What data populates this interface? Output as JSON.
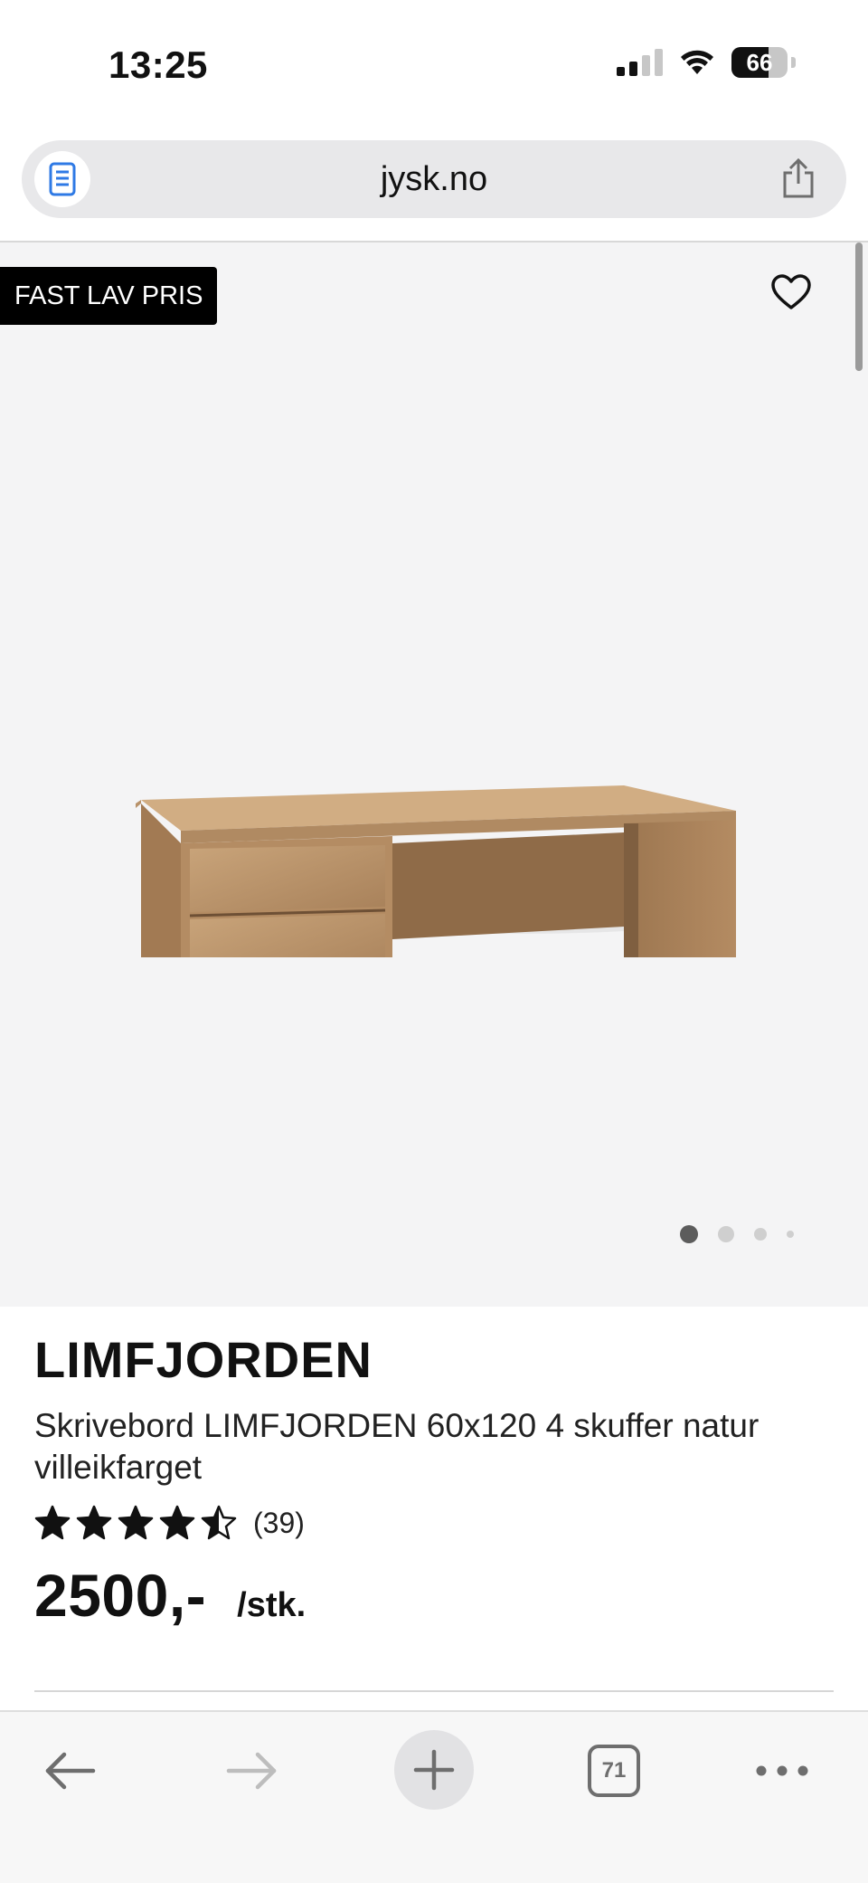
{
  "status_bar": {
    "time": "13:25",
    "battery_percent": "66",
    "battery_level": 0.66,
    "icons": [
      "signal-icon",
      "wifi-icon",
      "battery-icon"
    ]
  },
  "browser": {
    "url": "jysk.no",
    "icons": [
      "reader-mode-icon",
      "share-icon"
    ]
  },
  "gallery": {
    "badge": "FAST LAV PRIS",
    "icons": [
      "heart-icon"
    ],
    "image_count": 4,
    "active_image": 1
  },
  "product": {
    "brand": "LIMFJORDEN",
    "description": "Skrivebord LIMFJORDEN 60x120 4 skuffer natur villeikfarget",
    "rating": 4.5,
    "rating_max": 5,
    "review_count": "(39)",
    "price": "2500,-",
    "unit": "/stk."
  },
  "toolbar": {
    "tab_count": "71",
    "icons": [
      "back-arrow-icon",
      "forward-arrow-icon",
      "plus-icon",
      "tabs-icon",
      "more-icon"
    ]
  },
  "colors": {
    "badge_bg": "#000000",
    "gallery_bg": "#f4f4f5",
    "accent_reader": "#2f7ae5"
  }
}
